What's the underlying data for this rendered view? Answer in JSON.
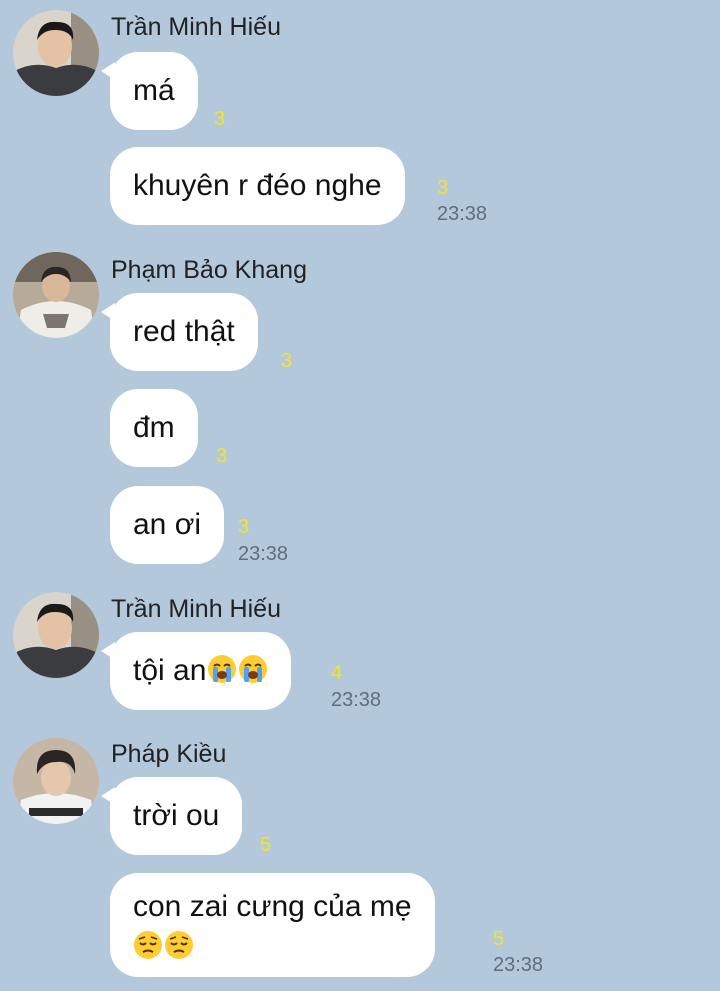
{
  "messages": [
    {
      "sender": "Trần Minh Hiếu",
      "bubbles": [
        {
          "text": "má",
          "count": "3"
        },
        {
          "text": "khuyên r đéo nghe",
          "count": "3",
          "time": "23:38"
        }
      ]
    },
    {
      "sender": "Phạm Bảo Khang",
      "bubbles": [
        {
          "text": "red thật",
          "count": "3"
        },
        {
          "text": "đm",
          "count": "3"
        },
        {
          "text": "an ơi",
          "count": "3",
          "time": "23:38"
        }
      ]
    },
    {
      "sender": "Trần Minh Hiếu",
      "bubbles": [
        {
          "text": "tội an",
          "emojis": [
            "loudly-crying-face",
            "loudly-crying-face"
          ],
          "count": "4",
          "time": "23:38"
        }
      ]
    },
    {
      "sender": "Pháp Kiều",
      "bubbles": [
        {
          "text": "trời ou",
          "count": "5"
        },
        {
          "text": "con zai cưng của mẹ",
          "emojis": [
            "pensive-face",
            "pensive-face"
          ],
          "count": "5",
          "time": "23:38"
        }
      ]
    }
  ],
  "colors": {
    "background": "#b4c8dc",
    "bubble": "#ffffff",
    "read_count": "#f5e32b",
    "time": "#5f6e7d"
  }
}
